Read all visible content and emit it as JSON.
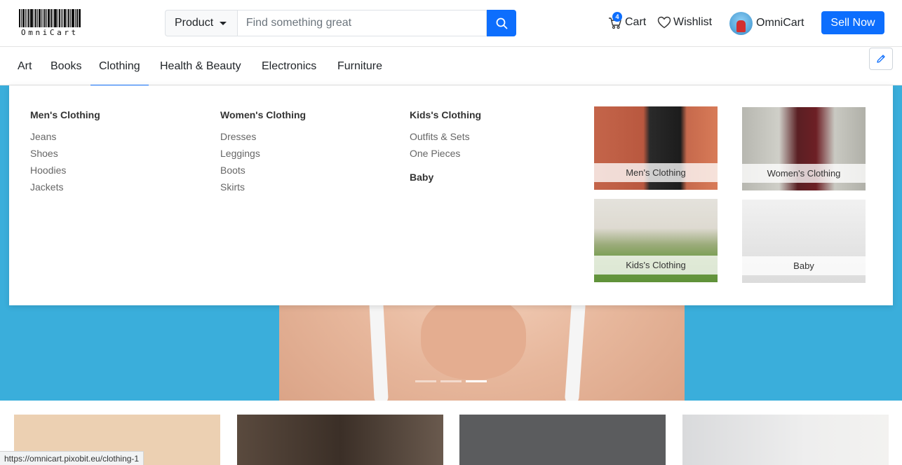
{
  "header": {
    "logo_text": "OmniCart",
    "search": {
      "category": "Product",
      "placeholder": "Find something great"
    },
    "cart": {
      "label": "Cart",
      "count": "4"
    },
    "wishlist": {
      "label": "Wishlist"
    },
    "user": {
      "name": "OmniCart"
    },
    "sell_label": "Sell Now"
  },
  "nav": {
    "items": [
      {
        "label": "Art"
      },
      {
        "label": "Books"
      },
      {
        "label": "Clothing"
      },
      {
        "label": "Health & Beauty"
      },
      {
        "label": "Electronics"
      },
      {
        "label": "Furniture"
      }
    ],
    "active": "Clothing"
  },
  "mega_menu": {
    "columns": [
      {
        "heading": "Men's Clothing",
        "links": [
          "Jeans",
          "Shoes",
          "Hoodies",
          "Jackets"
        ]
      },
      {
        "heading": "Women's Clothing",
        "links": [
          "Dresses",
          "Leggings",
          "Boots",
          "Skirts"
        ]
      },
      {
        "heading": "Kids's Clothing",
        "links": [
          "Outfits & Sets",
          "One Pieces"
        ]
      },
      {
        "heading": "Baby",
        "links": []
      }
    ],
    "tiles": [
      {
        "label": "Men's Clothing"
      },
      {
        "label": "Women's Clothing"
      },
      {
        "label": "Kids's Clothing"
      },
      {
        "label": "Baby"
      }
    ]
  },
  "carousel": {
    "slides": 3,
    "active_slide": 3
  },
  "status_bar": {
    "url": "https://omnicart.pixobit.eu/clothing-1"
  },
  "colors": {
    "primary": "#0d6efd",
    "hero_bg": "#3aaedb"
  }
}
